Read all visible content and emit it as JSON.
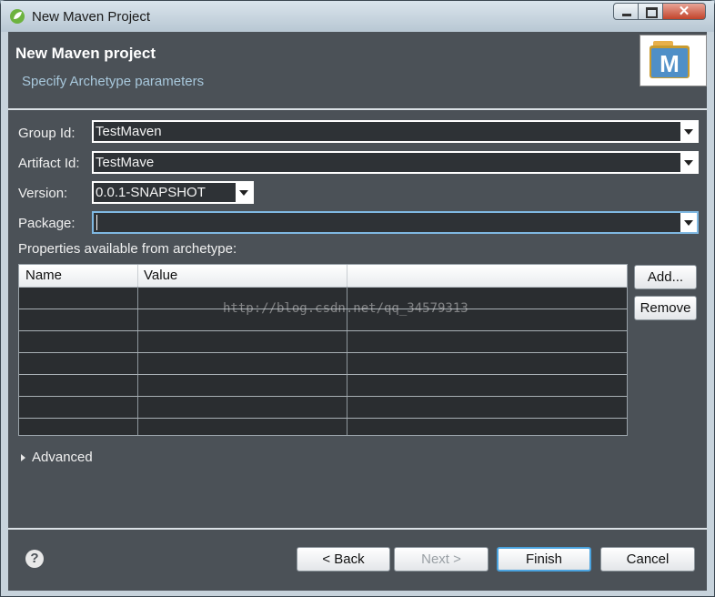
{
  "window": {
    "title": "New Maven Project",
    "app_icon": "spring-leaf-icon"
  },
  "header": {
    "title": "New Maven project",
    "subtitle": "Specify Archetype parameters",
    "logo_icon": "maven-m-logo"
  },
  "form": {
    "group_id": {
      "label": "Group Id:",
      "value": "TestMaven"
    },
    "artifact_id": {
      "label": "Artifact Id:",
      "value": "TestMave"
    },
    "version": {
      "label": "Version:",
      "value": "0.0.1-SNAPSHOT"
    },
    "package": {
      "label": "Package:",
      "value": ""
    }
  },
  "properties": {
    "label": "Properties available from archetype:",
    "columns": [
      "Name",
      "Value",
      ""
    ],
    "add_label": "Add...",
    "remove_label": "Remove"
  },
  "advanced": {
    "label": "Advanced"
  },
  "watermark": "http://blog.csdn.net/qq_34579313",
  "footer": {
    "back": "< Back",
    "next": "Next >",
    "finish": "Finish",
    "cancel": "Cancel",
    "help_icon": "question-icon"
  },
  "colors": {
    "panel": "#4b5157",
    "accent": "#4aa3df",
    "subtitle": "#a8c8dc"
  }
}
